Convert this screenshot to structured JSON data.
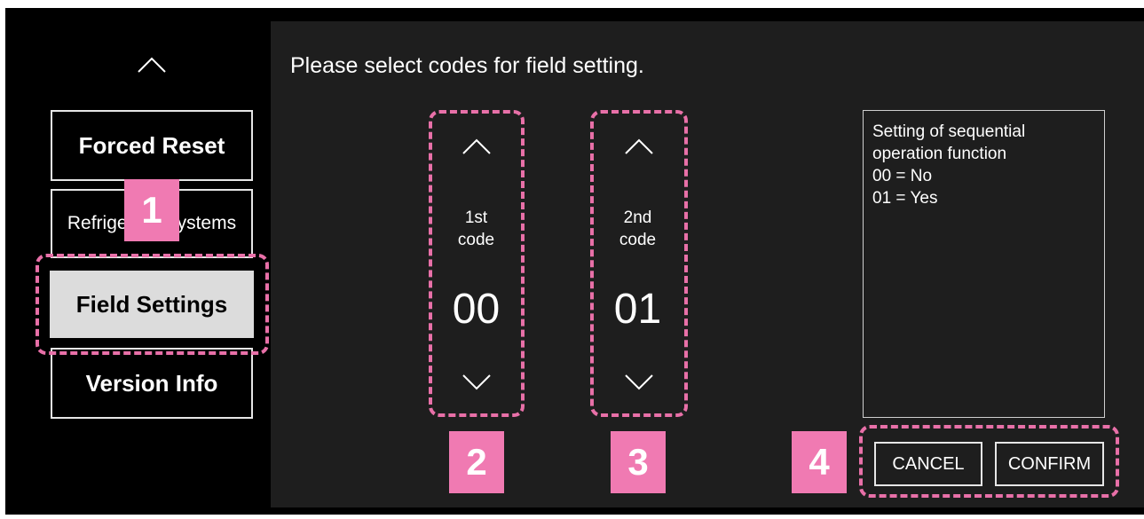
{
  "sidebar": {
    "scroll_up_icon": "chevron-up-icon",
    "items": [
      {
        "label": "Forced Reset"
      },
      {
        "label": "Refrigerant Systems"
      },
      {
        "label": "Field Settings"
      },
      {
        "label": "Version Info"
      }
    ]
  },
  "main": {
    "title": "Please select codes for field setting.",
    "pickers": [
      {
        "label_line1": "1st",
        "label_line2": "code",
        "value": "00"
      },
      {
        "label_line1": "2nd",
        "label_line2": "code",
        "value": "01"
      }
    ],
    "description": {
      "lines": [
        "Setting of sequential",
        "operation function",
        "00 = No",
        "01 = Yes"
      ]
    },
    "buttons": {
      "cancel": "CANCEL",
      "confirm": "CONFIRM"
    }
  },
  "callouts": [
    "1",
    "2",
    "3",
    "4"
  ],
  "colors": {
    "callout_pink": "#f07ab2",
    "dash_pink": "#e870a8",
    "screen_bg": "#000000",
    "panel_bg": "#1e1e1e",
    "active_item_bg": "#dcdcdc"
  }
}
